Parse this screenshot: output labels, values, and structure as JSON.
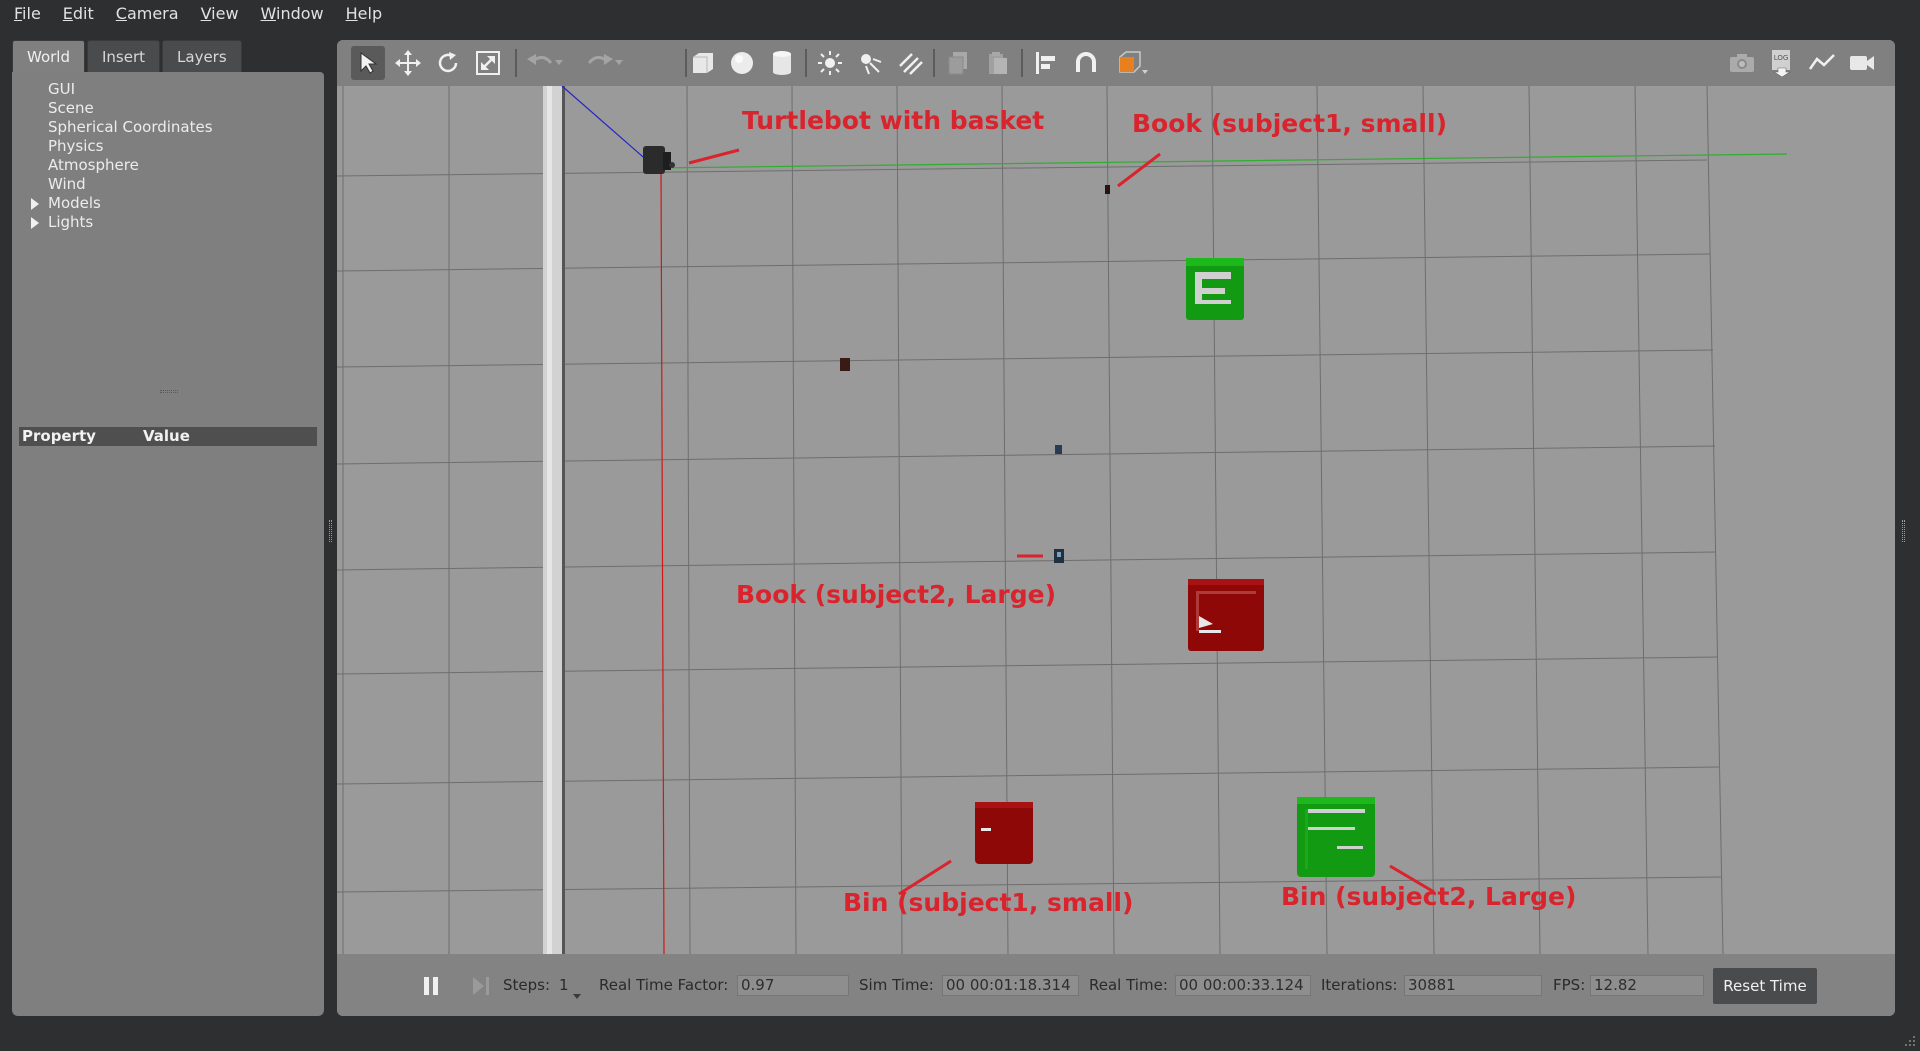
{
  "menubar": {
    "items": [
      {
        "first": "F",
        "rest": "ile"
      },
      {
        "first": "E",
        "rest": "dit"
      },
      {
        "first": "C",
        "rest": "amera"
      },
      {
        "first": "V",
        "rest": "iew"
      },
      {
        "first": "W",
        "rest": "indow"
      },
      {
        "first": "H",
        "rest": "elp"
      }
    ]
  },
  "left_panel": {
    "tabs": [
      "World",
      "Insert",
      "Layers"
    ],
    "active_tab": "World",
    "tree": [
      {
        "label": "GUI",
        "expandable": false
      },
      {
        "label": "Scene",
        "expandable": false
      },
      {
        "label": "Spherical Coordinates",
        "expandable": false
      },
      {
        "label": "Physics",
        "expandable": false
      },
      {
        "label": "Atmosphere",
        "expandable": false
      },
      {
        "label": "Wind",
        "expandable": false
      },
      {
        "label": "Models",
        "expandable": true
      },
      {
        "label": "Lights",
        "expandable": true
      }
    ],
    "property_header": {
      "property": "Property",
      "value": "Value"
    }
  },
  "toolbar": {
    "left_icons": [
      "select-arrow-icon",
      "translate-icon",
      "rotate-icon",
      "scale-icon",
      "undo-icon",
      "redo-icon",
      "box-shape-icon",
      "sphere-shape-icon",
      "cylinder-shape-icon",
      "point-light-icon",
      "spot-light-icon",
      "directional-light-icon",
      "copy-icon",
      "paste-icon",
      "align-icon",
      "snap-icon",
      "view-angle-icon"
    ],
    "right_icons": [
      "screenshot-icon",
      "log-icon",
      "plot-icon",
      "video-record-icon"
    ],
    "log_text": "LOG",
    "accent": "#e8801f"
  },
  "annotations": {
    "turtlebot": "Turtlebot with basket",
    "book1": "Book (subject1, small)",
    "book2": "Book (subject2, Large)",
    "bin1": "Bin (subject1, small)",
    "bin2": "Bin (subject2, Large)",
    "color": "#d9232d"
  },
  "scene_colors": {
    "green_bin": "#139a13",
    "red_bin": "#8f0808",
    "x_axis": "#d01818",
    "y_axis": "#2fae2f",
    "z_axis": "#2424c8"
  },
  "statusbar": {
    "steps_label": "Steps:",
    "steps_value": "1",
    "rtf_label": "Real Time Factor:",
    "rtf_value": "0.97",
    "sim_time_label": "Sim Time:",
    "sim_time_value": "00 00:01:18.314",
    "real_time_label": "Real Time:",
    "real_time_value": "00 00:00:33.124",
    "iterations_label": "Iterations:",
    "iterations_value": "30881",
    "fps_label": "FPS:",
    "fps_value": "12.82",
    "reset_label": "Reset Time"
  }
}
